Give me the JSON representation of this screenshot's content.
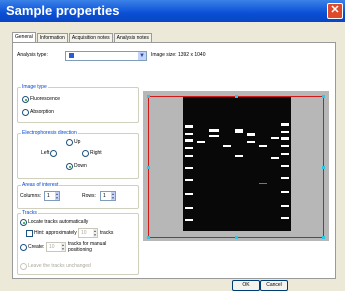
{
  "window": {
    "title": "Sample properties"
  },
  "tabs": [
    {
      "label": "General"
    },
    {
      "label": "Information"
    },
    {
      "label": "Acquisition notes"
    },
    {
      "label": "Analysis notes"
    }
  ],
  "analysis": {
    "label": "Analysis type:",
    "image_size": "Image size: 1392 x 1040"
  },
  "image_type": {
    "title": "Image type",
    "fluorescence": "Fluorescence",
    "absorption": "Absorption"
  },
  "direction": {
    "title": "Electrophoresis direction",
    "up": "Up",
    "left": "Left",
    "right": "Right",
    "down": "Down"
  },
  "areas": {
    "title": "Areas of interest",
    "columns_label": "Columns:",
    "columns_value": "1",
    "rows_label": "Rows:",
    "rows_value": "1"
  },
  "tracks": {
    "title": "Tracks",
    "locate": "Locate tracks automatically",
    "hint": "Hint: approximately",
    "hint_value": "10",
    "hint_unit": "tracks",
    "create": "Create:",
    "create_value": "10",
    "create_unit_1": "tracks for manual",
    "create_unit_2": "positioning",
    "leave": "Leave the tracks unchanged"
  },
  "buttons": {
    "ok": "OK",
    "cancel": "Cancel"
  }
}
